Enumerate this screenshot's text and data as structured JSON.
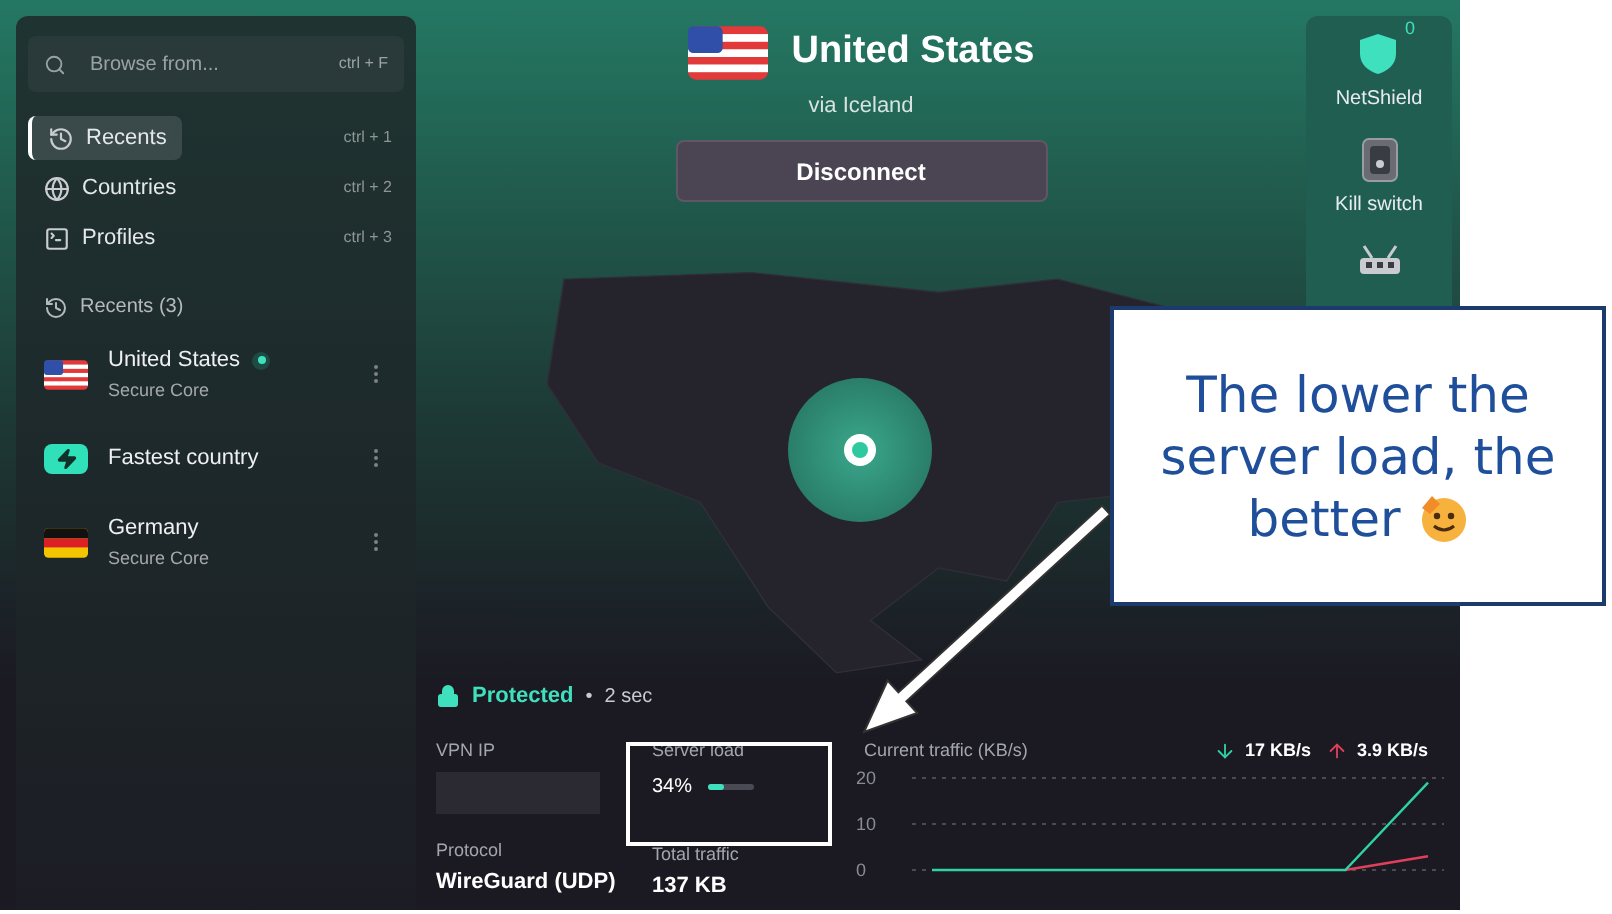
{
  "search": {
    "placeholder": "Browse from...",
    "shortcut": "ctrl + F"
  },
  "nav": [
    {
      "kind": "recents",
      "label": "Recents",
      "shortcut": "ctrl + 1",
      "selected": true
    },
    {
      "kind": "countries",
      "label": "Countries",
      "shortcut": "ctrl + 2",
      "selected": false
    },
    {
      "kind": "profiles",
      "label": "Profiles",
      "shortcut": "ctrl + 3",
      "selected": false
    }
  ],
  "recents": {
    "heading": "Recents (3)",
    "items": [
      {
        "kind": "us",
        "name": "United States",
        "subtitle": "Secure Core",
        "connected": true
      },
      {
        "kind": "fastest",
        "name": "Fastest country",
        "connected": false
      },
      {
        "kind": "de",
        "name": "Germany",
        "subtitle": "Secure Core",
        "connected": false
      }
    ]
  },
  "header": {
    "country": "United States",
    "via": "via Iceland",
    "button": "Disconnect"
  },
  "features": [
    {
      "kind": "netshield",
      "label": "NetShield",
      "badge": "0"
    },
    {
      "kind": "killswitch",
      "label": "Kill switch"
    },
    {
      "kind": "router"
    }
  ],
  "status": {
    "label": "Protected",
    "separator": "•",
    "time": "2 sec"
  },
  "stats": {
    "vpn_ip": {
      "label": "VPN IP"
    },
    "server_load": {
      "label": "Server load",
      "value": "34%",
      "level": 0.34
    },
    "protocol": {
      "label": "Protocol",
      "value": "WireGuard (UDP)"
    },
    "total_traffic": {
      "label": "Total traffic",
      "value": "137 KB"
    },
    "traffic": {
      "label": "Current traffic (KB/s)",
      "download": "17 KB/s",
      "upload": "3.9 KB/s",
      "chart_data": {
        "type": "line",
        "ylim": [
          0,
          20
        ],
        "yticks": [
          20,
          10,
          0
        ],
        "series": [
          {
            "color": "#2fd1a8",
            "values": [
              0,
              0,
              0,
              0,
              0,
              0,
              19
            ]
          },
          {
            "color": "#e0405a",
            "values": [
              null,
              null,
              null,
              null,
              null,
              0,
              3
            ]
          }
        ]
      }
    }
  },
  "callout": {
    "text": "The lower the server load, the better"
  }
}
